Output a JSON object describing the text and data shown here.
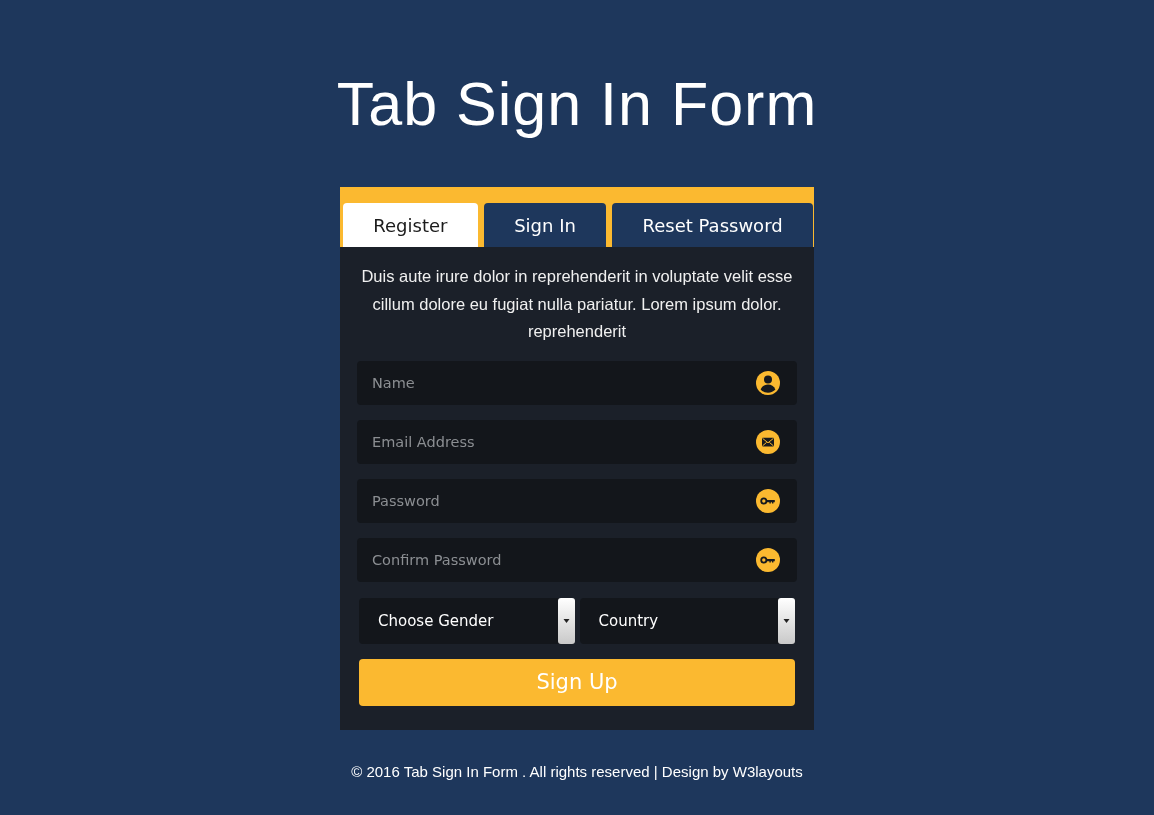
{
  "title": "Tab Sign In Form",
  "tabs": [
    {
      "label": "Register",
      "selected": true
    },
    {
      "label": "Sign In",
      "selected": false
    },
    {
      "label": "Reset Password",
      "selected": false
    }
  ],
  "form": {
    "description": "Duis aute irure dolor in reprehenderit in voluptate velit esse cillum dolore eu fugiat nulla pariatur. Lorem ipsum dolor. reprehenderit",
    "fields": [
      {
        "kind": "person",
        "placeholder": "Name"
      },
      {
        "kind": "email",
        "placeholder": "Email Address"
      },
      {
        "kind": "password",
        "placeholder": "Password"
      },
      {
        "kind": "password",
        "placeholder": "Confirm Password"
      }
    ],
    "dropdowns": [
      {
        "value": "Choose Gender"
      },
      {
        "value": "Country"
      }
    ],
    "submit": "Sign Up"
  },
  "footer": "© 2016 Tab Sign In Form . All rights reserved | Design by W3layouts"
}
